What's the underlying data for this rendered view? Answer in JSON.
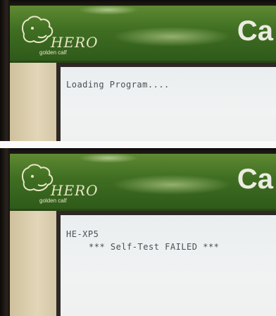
{
  "photo1": {
    "brand": "HERO",
    "subtitle": "golden calf",
    "banner_partial": "Ca",
    "line1": "Loading Program...."
  },
  "photo2": {
    "brand": "HERO",
    "subtitle": "golden calf",
    "banner_partial": "Ca",
    "line1": "HE-XP5",
    "line2": "*** Self-Test FAILED ***"
  },
  "colors": {
    "banner_green": "#3f6e22",
    "logo_cream": "#e9e6c6",
    "screen_bg": "#eef1f0",
    "terminal_text": "#4b4e55"
  }
}
